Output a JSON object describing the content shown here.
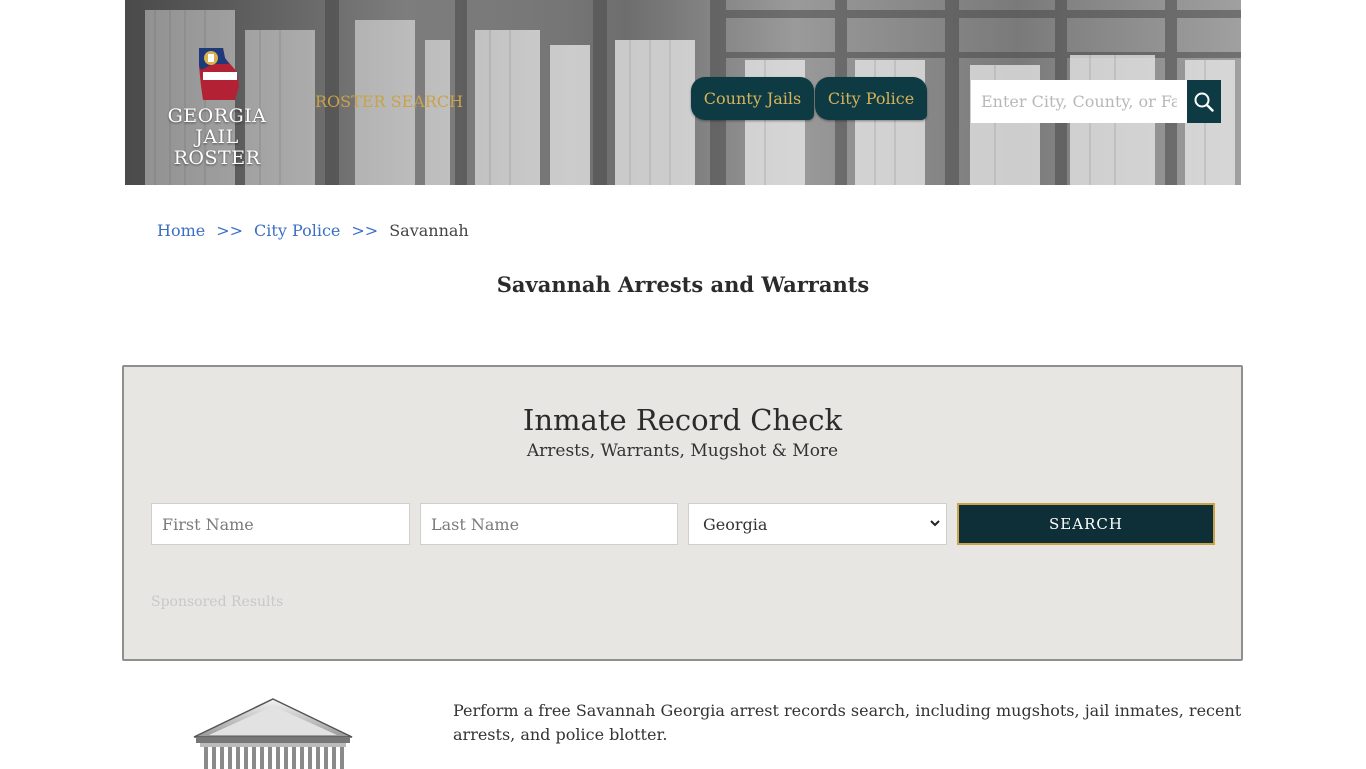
{
  "header": {
    "logo_line1": "GEORGIA",
    "logo_line2": "JAIL ROSTER",
    "roster_search_label": "ROSTER SEARCH",
    "nav_tabs": [
      {
        "label": "County Jails"
      },
      {
        "label": "City Police"
      }
    ],
    "search": {
      "placeholder": "Enter City, County, or Facility",
      "value": ""
    }
  },
  "breadcrumb": {
    "items": [
      {
        "label": "Home"
      },
      {
        "label": "City Police"
      }
    ],
    "separator": ">>",
    "current": "Savannah"
  },
  "page_title": "Savannah Arrests and Warrants",
  "record_check": {
    "title": "Inmate Record Check",
    "subtitle": "Arrests, Warrants, Mugshot & More",
    "first_name_placeholder": "First Name",
    "last_name_placeholder": "Last Name",
    "state_selected": "Georgia",
    "submit_label": "SEARCH",
    "sponsored_label": "Sponsored Results"
  },
  "intro_text": "Perform a free Savannah Georgia arrest records search, including mugshots, jail inmates, recent arrests, and police blotter.",
  "colors": {
    "accent_dark": "#0e3b43",
    "accent_gold": "#c9a24a",
    "link": "#3a6fc4",
    "panel_bg": "#e7e6e2"
  },
  "icons": [
    "georgia-map-logo-icon",
    "search-icon",
    "chevron-down-icon",
    "courthouse-icon"
  ]
}
